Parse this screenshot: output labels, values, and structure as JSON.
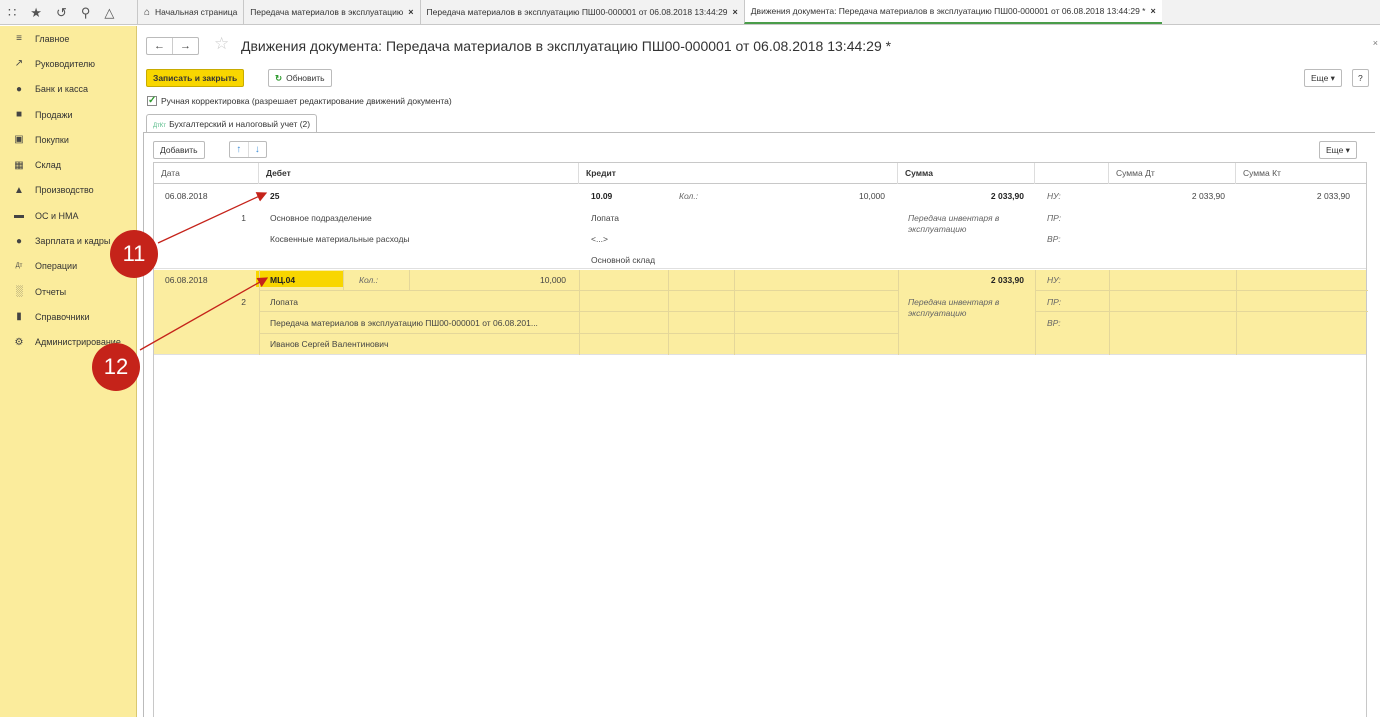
{
  "topbar": {
    "icons": [
      "apps-grid-icon",
      "star-icon",
      "history-icon",
      "search-icon",
      "bell-icon"
    ],
    "tabs": [
      {
        "label": "Начальная страница",
        "closable": false
      },
      {
        "label": "Передача материалов в эксплуатацию",
        "closable": true
      },
      {
        "label": "Передача материалов в эксплуатацию ПШ00-000001 от 06.08.2018 13:44:29",
        "closable": true
      },
      {
        "label": "Движения документа: Передача материалов в эксплуатацию ПШ00-000001 от 06.08.2018 13:44:29 *",
        "closable": true,
        "active": true
      }
    ]
  },
  "sidebar": {
    "items": [
      {
        "label": "Главное",
        "icon": "menu-icon"
      },
      {
        "label": "Руководителю",
        "icon": "trend-icon"
      },
      {
        "label": "Банк и касса",
        "icon": "coin-icon"
      },
      {
        "label": "Продажи",
        "icon": "bag-icon"
      },
      {
        "label": "Покупки",
        "icon": "cart-icon"
      },
      {
        "label": "Склад",
        "icon": "warehouse-icon"
      },
      {
        "label": "Производство",
        "icon": "factory-icon"
      },
      {
        "label": "ОС и НМА",
        "icon": "truck-icon"
      },
      {
        "label": "Зарплата и кадры",
        "icon": "person-icon"
      },
      {
        "label": "Операции",
        "icon": "dt-kt-icon"
      },
      {
        "label": "Отчеты",
        "icon": "bar-chart-icon"
      },
      {
        "label": "Справочники",
        "icon": "book-icon"
      },
      {
        "label": "Администрирование",
        "icon": "gear-icon"
      }
    ]
  },
  "header": {
    "title": "Движения документа: Передача материалов в эксплуатацию ПШ00-000001 от 06.08.2018 13:44:29 *"
  },
  "toolbar": {
    "save_close": "Записать и закрыть",
    "refresh": "Обновить",
    "more": "Еще",
    "help": "?"
  },
  "manual_edit": {
    "checked": true,
    "label": "Ручная корректировка (разрешает редактирование движений документа)"
  },
  "ledger_tab": {
    "icon": "ДтКт",
    "label": "Бухгалтерский и налоговый учет (2)"
  },
  "table_toolbar": {
    "add": "Добавить",
    "up": "↑",
    "down": "↓",
    "more": "Еще"
  },
  "table": {
    "columns": [
      "Дата",
      "Дебет",
      "Кредит",
      "Сумма",
      "",
      "Сумма Дт",
      "Сумма Кт"
    ],
    "rows": [
      {
        "date": "06.08.2018",
        "num": "1",
        "debit_account": "25",
        "debit_sub1": "Основное подразделение",
        "debit_sub2": "Косвенные материальные расходы",
        "credit_account": "10.09",
        "credit_qty_label": "Кол.:",
        "credit_qty": "10,000",
        "credit_sub1": "Лопата",
        "credit_sub2": "<...>",
        "credit_sub3": "Основной склад",
        "sum": "2 033,90",
        "content": "Передача инвентаря в эксплуатацию",
        "nu": "НУ:",
        "pr": "ПР:",
        "vr": "ВР:",
        "sum_dt": "2 033,90",
        "sum_kt": "2 033,90"
      },
      {
        "date": "06.08.2018",
        "num": "2",
        "debit_account": "МЦ.04",
        "debit_qty_label": "Кол.:",
        "debit_qty": "10,000",
        "debit_sub1": "Лопата",
        "debit_sub2": "Передача материалов в эксплуатацию ПШ00-000001 от 06.08.201...",
        "debit_sub3": "Иванов Сергей Валентинович",
        "sum": "2 033,90",
        "content": "Передача инвентаря в эксплуатацию",
        "nu": "НУ:",
        "pr": "ПР:",
        "vr": "ВР:"
      }
    ]
  },
  "callouts": [
    "11",
    "12"
  ],
  "colors": {
    "sidebar_bg": "#fbec9c",
    "selected_row_bg": "#fbeda0",
    "primary_button": "#f8d600",
    "callout": "#c5231a",
    "arrow": "#c5231a"
  }
}
